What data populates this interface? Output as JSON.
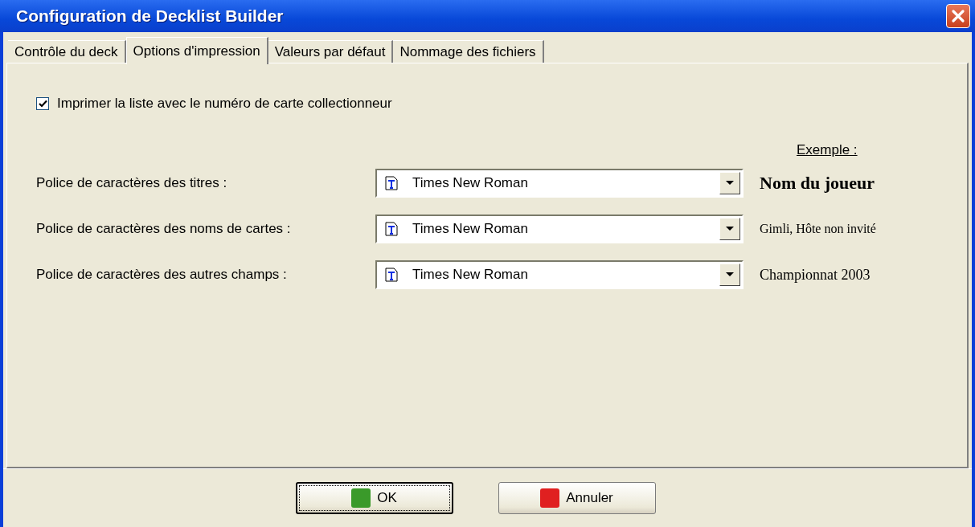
{
  "window": {
    "title": "Configuration de Decklist Builder"
  },
  "tabs": [
    {
      "label": "Contrôle du deck",
      "selected": false
    },
    {
      "label": "Options d'impression",
      "selected": true
    },
    {
      "label": "Valeurs par défaut",
      "selected": false
    },
    {
      "label": "Nommage des fichiers",
      "selected": false
    }
  ],
  "print_option": {
    "label": "Imprimer la liste avec le numéro de carte collectionneur",
    "checked": true
  },
  "example_heading": "Exemple :",
  "font_rows": [
    {
      "label": "Police de caractères des titres :",
      "value": "Times New Roman",
      "example": "Nom du joueur",
      "kind": "bold"
    },
    {
      "label": "Police de caractères des noms de cartes :",
      "value": "Times New Roman",
      "example": "Gimli, Hôte non invité",
      "kind": "plain"
    },
    {
      "label": "Police de caractères des autres champs :",
      "value": "Times New Roman",
      "example": "Championnat 2003",
      "kind": "medium"
    }
  ],
  "buttons": [
    {
      "label": "OK",
      "color": "#3a9a2a",
      "default": true
    },
    {
      "label": "Annuler",
      "color": "#e02020",
      "default": false
    }
  ]
}
